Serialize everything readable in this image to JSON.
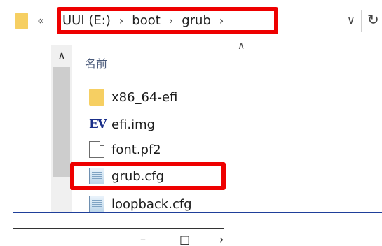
{
  "breadcrumb": {
    "prefix": "«",
    "items": [
      "UUI (E:)",
      "boot",
      "grub"
    ],
    "separator": "›",
    "trailing": "›"
  },
  "address_controls": {
    "dropdown": "∨",
    "refresh": "↻"
  },
  "scrollbar": {
    "up": "∧"
  },
  "column": {
    "sort_caret": "∧",
    "name_header": "名前"
  },
  "files": [
    {
      "name": "x86_64-efi",
      "icon": "folder-icon"
    },
    {
      "name": "efi.img",
      "icon": "ev-icon",
      "icon_text": "EV"
    },
    {
      "name": "font.pf2",
      "icon": "document-icon"
    },
    {
      "name": "grub.cfg",
      "icon": "config-file-icon",
      "highlighted": true
    },
    {
      "name": "loopback.cfg",
      "icon": "config-file-icon"
    }
  ],
  "window_controls": {
    "minimize": "–",
    "maximize": "□",
    "close": "›"
  },
  "colors": {
    "highlight": "#ee0000",
    "folder": "#f6cf62",
    "border": "#1f3f9a"
  }
}
